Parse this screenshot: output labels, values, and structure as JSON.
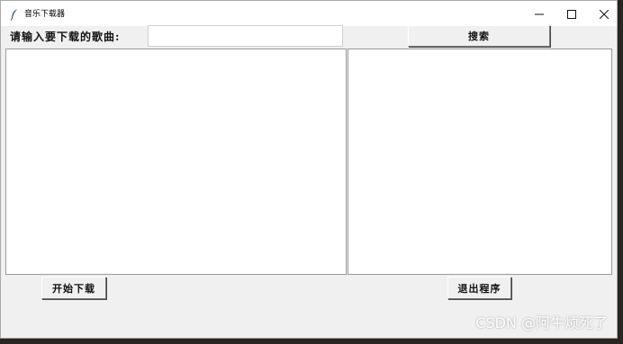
{
  "window": {
    "title": "音乐下载器",
    "title_icon": "feather-icon",
    "controls": [
      "minimize-icon",
      "maximize-icon",
      "close-icon"
    ]
  },
  "search": {
    "label": "请输入要下载的歌曲:",
    "value": "",
    "button_label": "搜索"
  },
  "lists": {
    "left_items": [],
    "right_items": []
  },
  "actions": {
    "download_label": "开始下载",
    "exit_label": "退出程序"
  },
  "watermark": "CSDN @阿牛烦死了",
  "colors": {
    "window_bg": "#f0f0f0",
    "listbox_bg": "#ffffff"
  }
}
